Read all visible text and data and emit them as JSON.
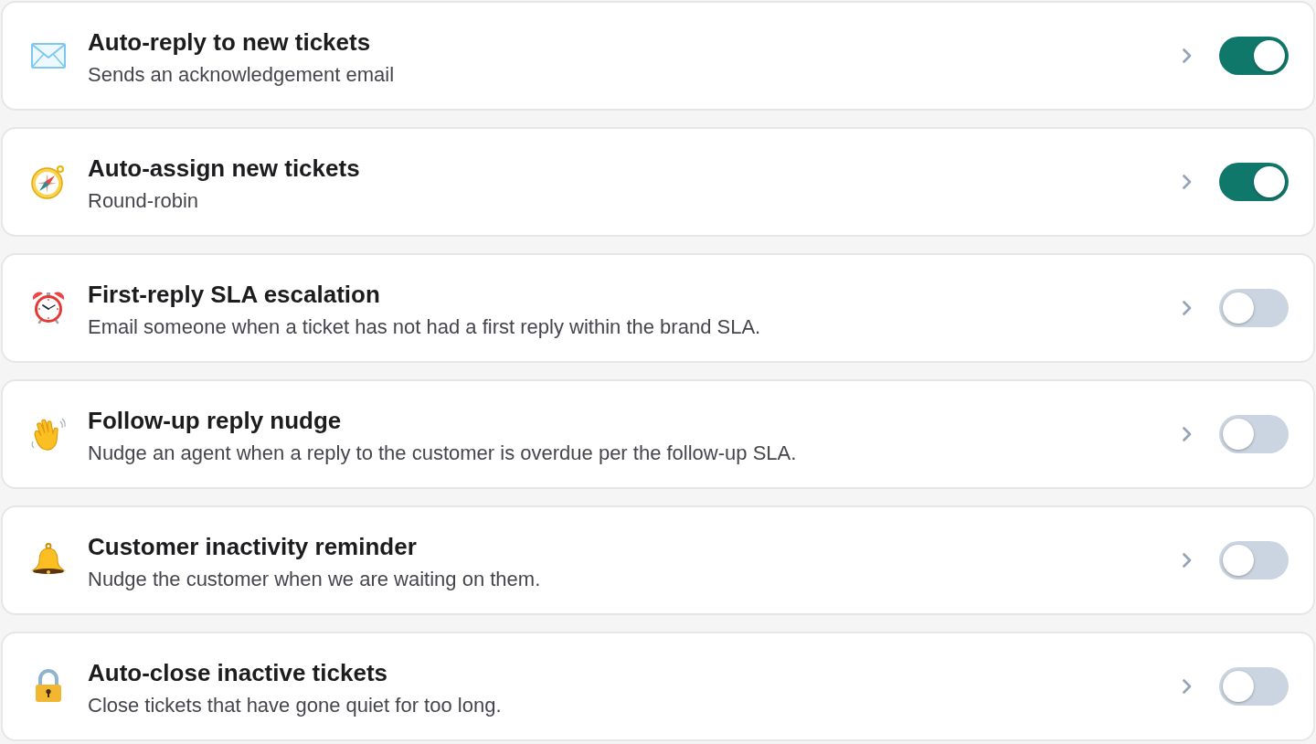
{
  "rules": [
    {
      "title": "Auto-reply to new tickets",
      "description": "Sends an acknowledgement email",
      "enabled": true
    },
    {
      "title": "Auto-assign new tickets",
      "description": "Round-robin",
      "enabled": true
    },
    {
      "title": "First-reply SLA escalation",
      "description": "Email someone when a ticket has not had a first reply within the brand SLA.",
      "enabled": false
    },
    {
      "title": "Follow-up reply nudge",
      "description": "Nudge an agent when a reply to the customer is overdue per the follow-up SLA.",
      "enabled": false
    },
    {
      "title": "Customer inactivity reminder",
      "description": "Nudge the customer when we are waiting on them.",
      "enabled": false
    },
    {
      "title": "Auto-close inactive tickets",
      "description": "Close tickets that have gone quiet for too long.",
      "enabled": false
    }
  ]
}
